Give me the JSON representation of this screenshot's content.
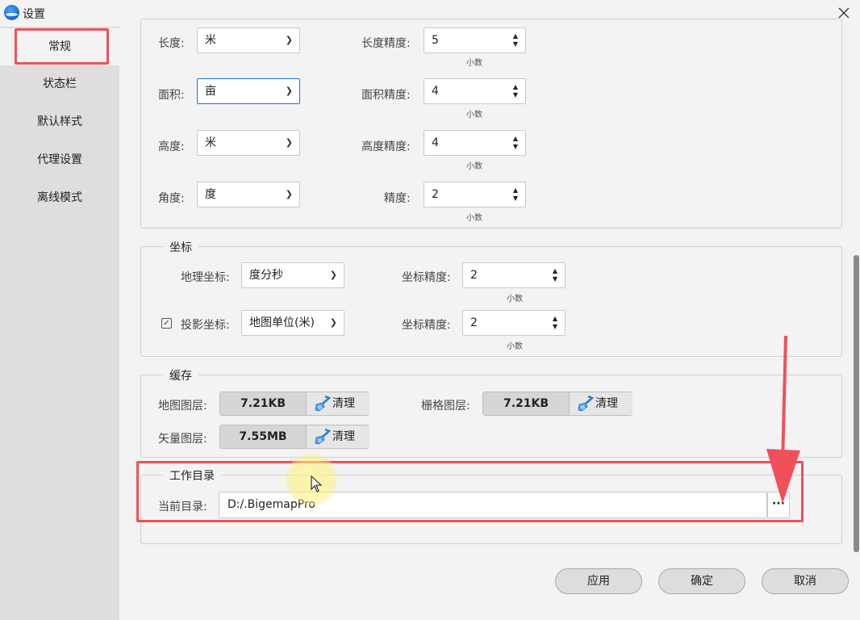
{
  "window": {
    "title": "设置"
  },
  "sidebar": {
    "items": [
      {
        "label": "常规",
        "active": true
      },
      {
        "label": "状态栏"
      },
      {
        "label": "默认样式"
      },
      {
        "label": "代理设置"
      },
      {
        "label": "离线模式"
      }
    ]
  },
  "measure": {
    "rows": [
      {
        "label": "长度:",
        "unit_value": "米",
        "precision_label": "长度精度:",
        "precision": "5",
        "decimal_text": "小数"
      },
      {
        "label": "面积:",
        "unit_value": "亩",
        "precision_label": "面积精度:",
        "precision": "4",
        "decimal_text": "小数"
      },
      {
        "label": "高度:",
        "unit_value": "米",
        "precision_label": "高度精度:",
        "precision": "4",
        "decimal_text": "小数"
      },
      {
        "label": "角度:",
        "unit_value": "度",
        "precision_label": "精度:",
        "precision": "2",
        "decimal_text": "小数"
      }
    ]
  },
  "coordinates": {
    "title": "坐标",
    "geo_label": "地理坐标:",
    "geo_value": "度分秒",
    "geo_precision_label": "坐标精度:",
    "geo_precision": "2",
    "geo_decimal_text": "小数",
    "proj_checked": true,
    "proj_label": "投影坐标:",
    "proj_value": "地图单位(米)",
    "proj_precision_label": "坐标精度:",
    "proj_precision": "2",
    "proj_decimal_text": "小数"
  },
  "cache": {
    "title": "缓存",
    "map_label": "地图图层:",
    "map_size": "7.21KB",
    "raster_label": "栅格图层:",
    "raster_size": "7.21KB",
    "vector_label": "矢量图层:",
    "vector_size": "7.55MB",
    "clean_label": "清理"
  },
  "workdir": {
    "title": "工作目录",
    "current_label": "当前目录:",
    "path": "D:/.BigemapPro",
    "browse_label": "···"
  },
  "footer": {
    "apply": "应用",
    "ok": "确定",
    "cancel": "取消"
  },
  "colors": {
    "annotation_red": "#f0505a",
    "focus_blue": "#1e6fd9",
    "sidebar_bg": "#dedede"
  }
}
